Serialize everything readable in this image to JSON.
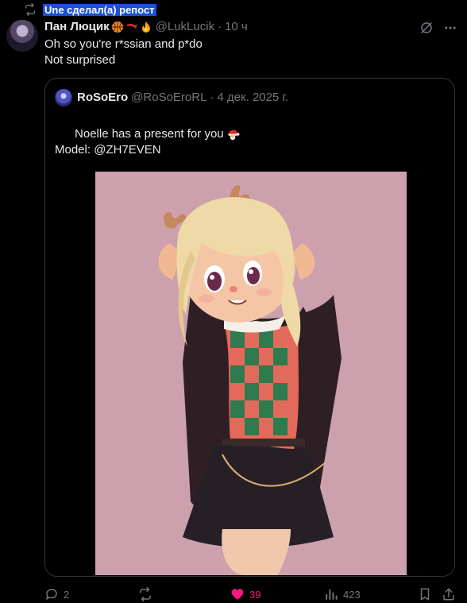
{
  "repost": {
    "label": "Une сделал(а) репост",
    "icon": "repost-icon"
  },
  "tweet": {
    "display_name": "Пан Люцик",
    "emojis": [
      "basketball-emoji",
      "chili-emoji",
      "fire-emoji"
    ],
    "handle": "@LukLucik",
    "separator": "·",
    "time": "10 ч",
    "lines": [
      "Oh so you're r*ssian and p*do",
      "Not surprised"
    ]
  },
  "quote": {
    "display_name": "RoSoEro",
    "handle": "@RoSoEroRL",
    "separator": "·",
    "date": "4 дек. 2025 г.",
    "lines": [
      "Noelle has a present for you",
      "",
      "Model: @ZH7EVEN"
    ],
    "emoji": "santa-emoji",
    "media_alt": "3D render of a fawn character in a checkered sweater vest and black skirt on a pink background"
  },
  "actions": {
    "replies": "2",
    "reposts": "",
    "likes": "39",
    "views": "423"
  },
  "colors": {
    "background": "#000000",
    "text": "#e7e9ea",
    "muted": "#71767b",
    "border": "#2f3336",
    "like": "#f91880",
    "highlight": "#1d4fd6",
    "media_bg": "#cda0ad"
  }
}
